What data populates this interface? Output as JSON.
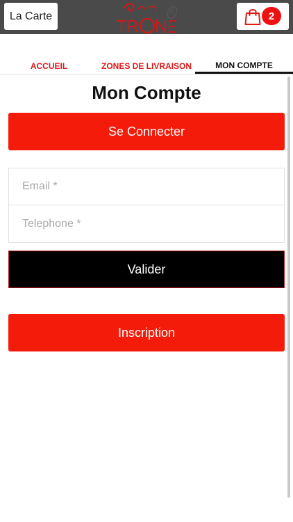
{
  "header": {
    "menu_label": "La Carte",
    "cart_count": "2",
    "logo_icon": "crown-logo-icon",
    "cart_icon": "shopping-bag-icon"
  },
  "tabs": [
    {
      "label": "ACCUEIL",
      "active": false
    },
    {
      "label": "ZONES DE LIVRAISON",
      "active": false
    },
    {
      "label": "MON COMPTE",
      "active": true
    }
  ],
  "main": {
    "title": "Mon Compte",
    "login_label": "Se Connecter",
    "email_placeholder": "Email *",
    "phone_placeholder": "Telephone *",
    "validate_label": "Valider",
    "register_label": "Inscription"
  },
  "colors": {
    "header_bg": "#4a4a4a",
    "accent_red": "#f41b0b",
    "tab_red": "#e01818",
    "validate_bg": "#000000"
  }
}
